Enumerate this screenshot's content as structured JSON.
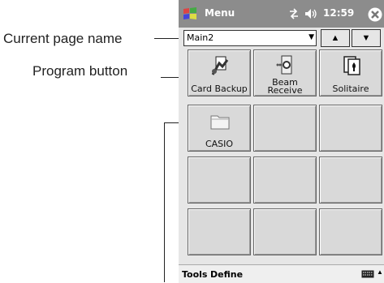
{
  "callouts": {
    "page_name": "Current page name",
    "program_button": "Program button"
  },
  "titlebar": {
    "title": "Menu",
    "time": "12:59"
  },
  "page_select": {
    "value": "Main2"
  },
  "tiles": [
    {
      "label": "Card Backup",
      "icon": "card-backup-icon"
    },
    {
      "label": "Beam Receive",
      "icon": "beam-receive-icon"
    },
    {
      "label": "Solitaire",
      "icon": "solitaire-icon"
    },
    {
      "label": "CASIO",
      "icon": "folder-icon"
    }
  ],
  "menubar": {
    "tools": "Tools",
    "define": "Define"
  },
  "colors": {
    "titlebar": "#8c8c8c",
    "tile": "#d9d9d9",
    "background": "#e6e6e6"
  }
}
